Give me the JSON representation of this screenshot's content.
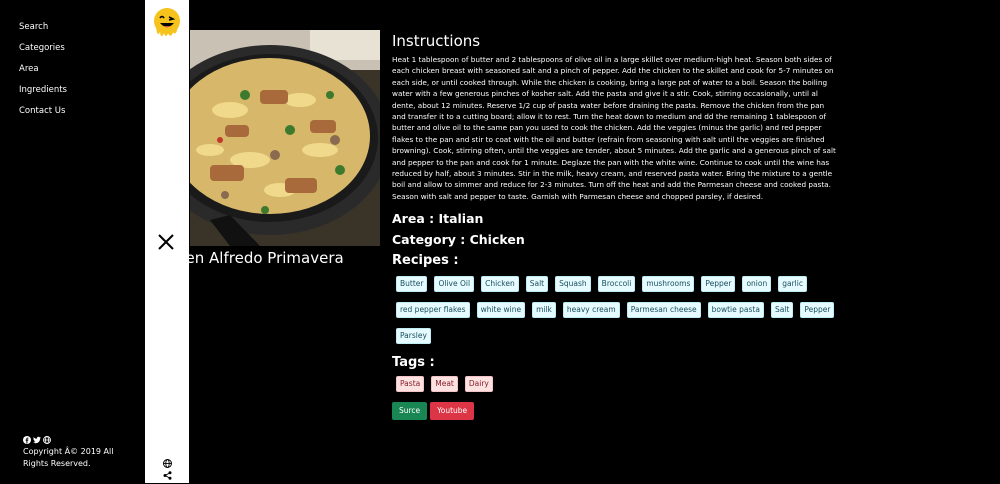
{
  "nav": {
    "items": [
      {
        "label": "Search"
      },
      {
        "label": "Categories"
      },
      {
        "label": "Area"
      },
      {
        "label": "Ingredients"
      },
      {
        "label": "Contact Us"
      }
    ]
  },
  "footer": {
    "copyright": "Copyright Â© 2019 All Rights Reserved."
  },
  "meal": {
    "title": "Chicken Alfredo Primavera",
    "instructions_heading": "Instructions",
    "instructions": "Heat 1 tablespoon of butter and 2 tablespoons of olive oil in a large skillet over medium-high heat. Season both sides of each chicken breast with seasoned salt and a pinch of pepper. Add the chicken to the skillet and cook for 5-7 minutes on each side, or until cooked through. While the chicken is cooking, bring a large pot of water to a boil. Season the boiling water with a few generous pinches of kosher salt. Add the pasta and give it a stir. Cook, stirring occasionally, until al dente, about 12 minutes. Reserve 1/2 cup of pasta water before draining the pasta. Remove the chicken from the pan and transfer it to a cutting board; allow it to rest. Turn the heat down to medium and dd the remaining 1 tablespoon of butter and olive oil to the same pan you used to cook the chicken. Add the veggies (minus the garlic) and red pepper flakes to the pan and stir to coat with the oil and butter (refrain from seasoning with salt until the veggies are finished browning). Cook, stirring often, until the veggies are tender, about 5 minutes. Add the garlic and a generous pinch of salt and pepper to the pan and cook for 1 minute. Deglaze the pan with the white wine. Continue to cook until the wine has reduced by half, about 3 minutes. Stir in the milk, heavy cream, and reserved pasta water. Bring the mixture to a gentle boil and allow to simmer and reduce for 2-3 minutes. Turn off the heat and add the Parmesan cheese and cooked pasta. Season with salt and pepper to taste. Garnish with Parmesan cheese and chopped parsley, if desired.",
    "area_label": "Area : Italian",
    "category_label": "Category : Chicken",
    "recipes_heading": "Recipes :",
    "ingredients": [
      "Butter",
      "Olive Oil",
      "Chicken",
      "Salt",
      "Squash",
      "Broccoli",
      "mushrooms",
      "Pepper",
      "onion",
      "garlic",
      "red pepper flakes",
      "white wine",
      "milk",
      "heavy cream",
      "Parmesan cheese",
      "bowtie pasta",
      "Salt",
      "Pepper",
      "Parsley"
    ],
    "tags_heading": "Tags :",
    "tags": [
      "Pasta",
      "Meat",
      "Dairy"
    ],
    "source_label": "Surce",
    "youtube_label": "Youtube"
  },
  "colors": {
    "background": "#000000",
    "panel": "#ffffff",
    "chip_bg": "#e6fbff",
    "tag_bg": "#fde2e2",
    "source_btn": "#198754",
    "youtube_btn": "#dc3545"
  },
  "icons": [
    "logo-icon",
    "close-icon",
    "globe-icon",
    "share-icon",
    "facebook-icon",
    "twitter-icon",
    "globe-small-icon"
  ]
}
